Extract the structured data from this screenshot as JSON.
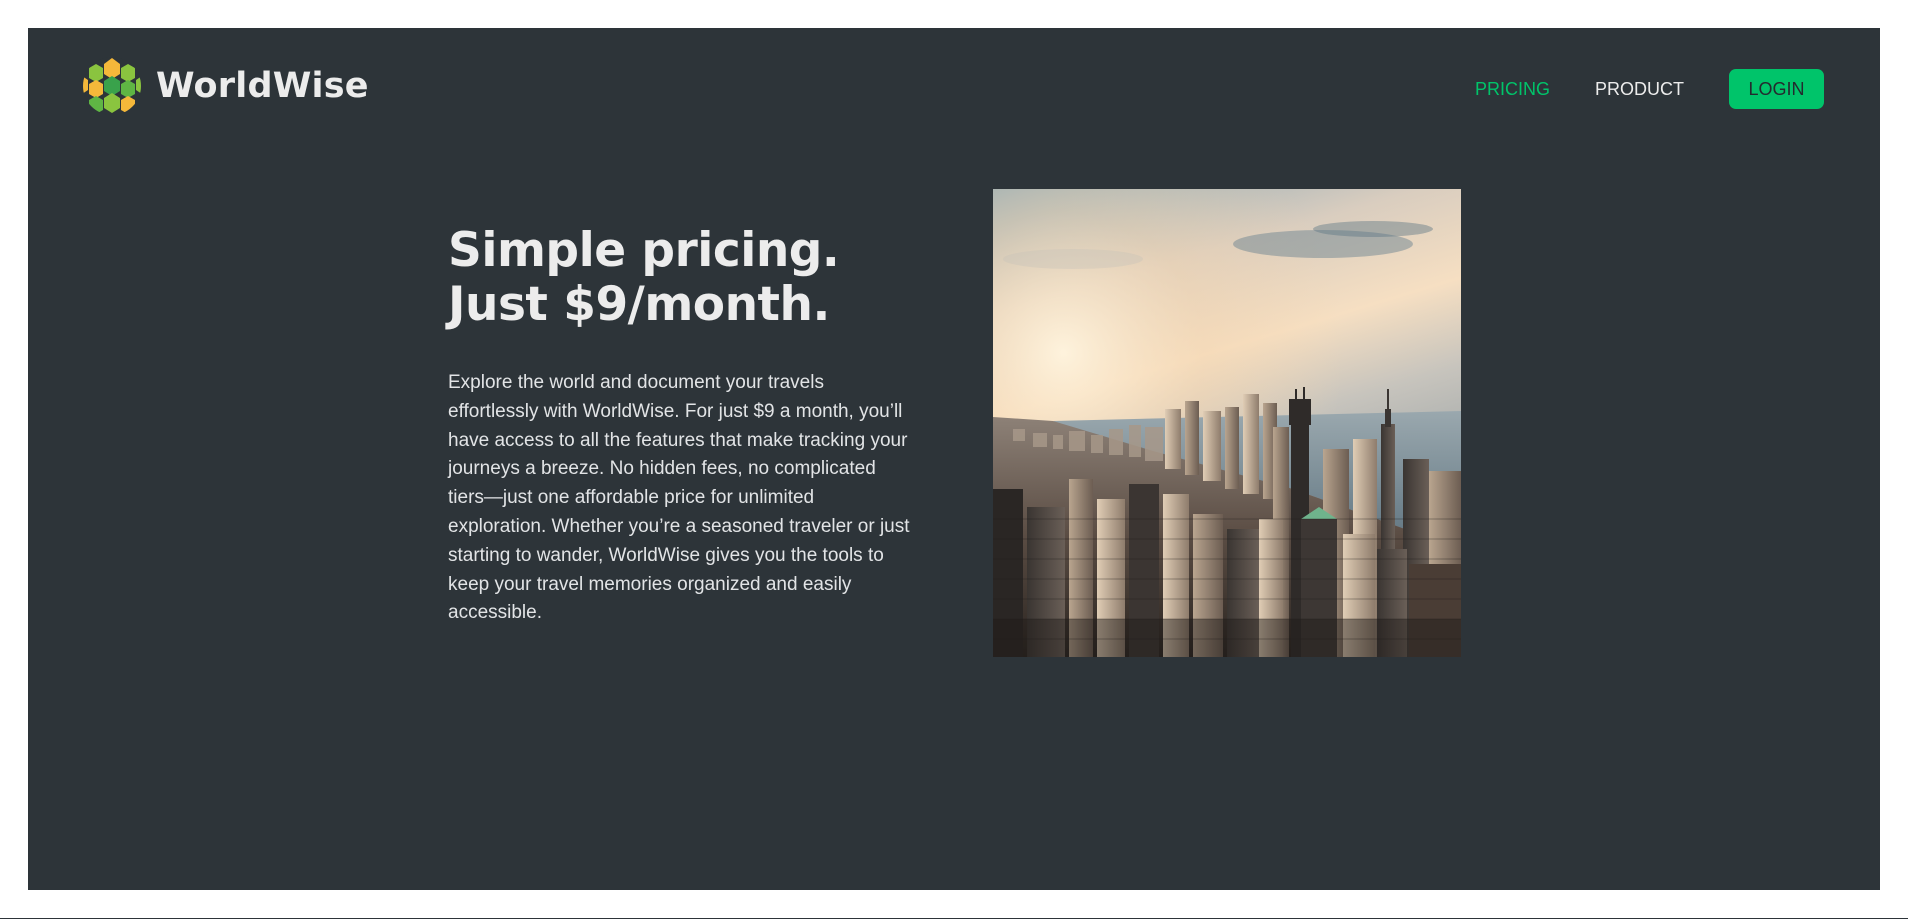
{
  "app": {
    "name": "WorldWise",
    "logo_icon": "globe-logo-icon"
  },
  "nav": {
    "links": [
      {
        "label": "PRICING",
        "active": true
      },
      {
        "label": "PRODUCT",
        "active": false
      }
    ],
    "login_label": "LOGIN"
  },
  "main": {
    "headline_line1": "Simple pricing.",
    "headline_line2": "Just $9/month.",
    "body": "Explore the world and document your travels effortlessly with WorldWise. For just $9 a month, you’ll have access to all the features that make tracking your journeys a breeze. No hidden fees, no complicated tiers—just one affordable price for unlimited exploration. Whether you’re a seasoned traveler or just starting to wander, WorldWise gives you the tools to keep your travel memories organized and easily accessible.",
    "image": "city-skyline-image"
  },
  "colors": {
    "background": "#2d3439",
    "accent": "#00c46a",
    "text": "#ececec"
  }
}
